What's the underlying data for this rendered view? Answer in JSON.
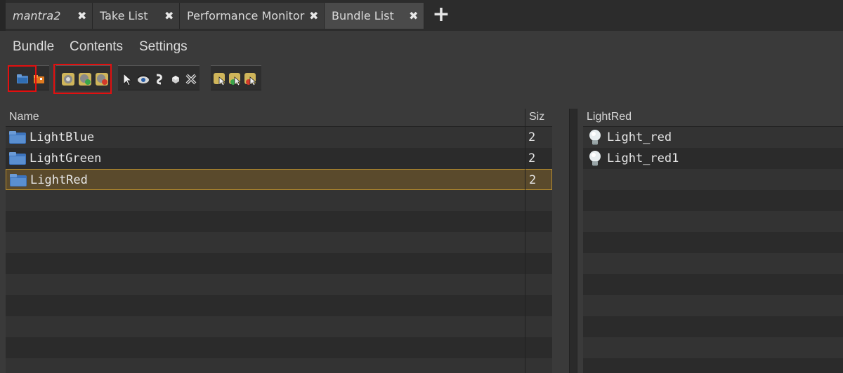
{
  "tabs": [
    {
      "label": "mantra2",
      "italic": true,
      "close": "✖"
    },
    {
      "label": "Take List",
      "close": "✖"
    },
    {
      "label": "Performance Monitor",
      "close": "✖"
    },
    {
      "label": "Bundle List",
      "close": "✖",
      "active": true
    }
  ],
  "add_tab": "+",
  "menu": {
    "bundle": "Bundle",
    "contents": "Contents",
    "settings": "Settings"
  },
  "toolbar": {
    "icons": [
      "new-bundle-icon",
      "new-folder-icon",
      "filter-gear-icon",
      "filter-add-icon",
      "filter-remove-icon",
      "select-arrow-icon",
      "visibility-eye-icon",
      "link-icon",
      "cube-icon",
      "delete-x-icon",
      "pick-node-icon",
      "pick-add-icon",
      "pick-remove-icon"
    ]
  },
  "bundles": {
    "columns": {
      "name": "Name",
      "size": "Siz"
    },
    "rows": [
      {
        "name": "LightBlue",
        "size": "2"
      },
      {
        "name": "LightGreen",
        "size": "2"
      },
      {
        "name": "LightRed",
        "size": "2",
        "selected": true
      }
    ]
  },
  "contents": {
    "header": "LightRed",
    "items": [
      {
        "name": "Light_red"
      },
      {
        "name": "Light_red1"
      }
    ]
  },
  "colors": {
    "highlight": "#e21010",
    "selected_row": "#5a4a2c",
    "selected_border": "#b38a2f"
  }
}
